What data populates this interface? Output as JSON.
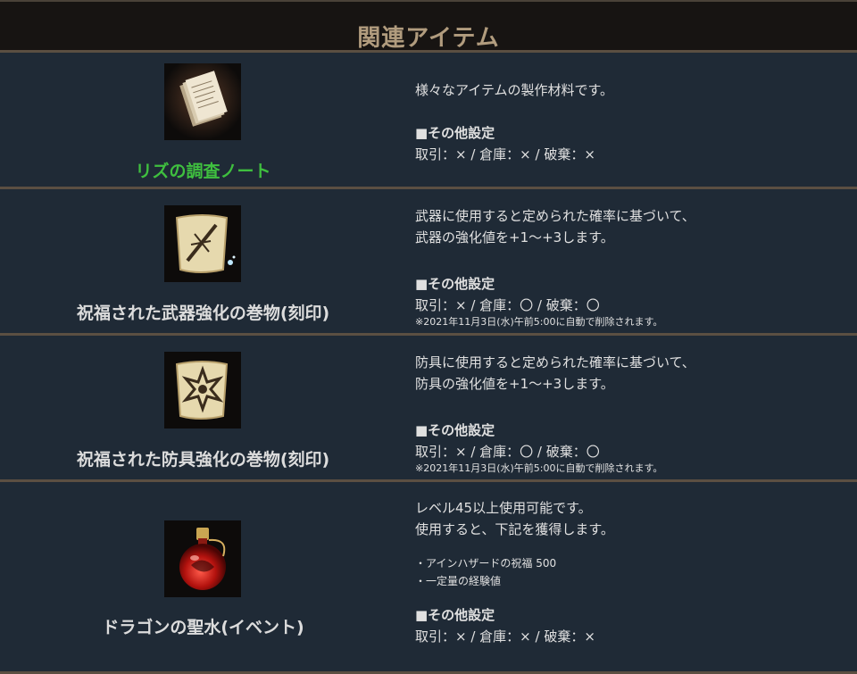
{
  "header": {
    "title": "関連アイテム"
  },
  "items": [
    {
      "name": "リズの調査ノート",
      "icon": "notes-icon",
      "desc": [
        "様々なアイテムの製作材料です。"
      ],
      "setting_label": "■その他設定",
      "setting_value": "取引：× / 倉庫：× / 破棄：×"
    },
    {
      "name": "祝福された武器強化の巻物(刻印)",
      "icon": "weapon-scroll-icon",
      "desc": [
        "武器に使用すると定められた確率に基づいて、",
        "武器の強化値を+1～+3します。"
      ],
      "setting_label": "■その他設定",
      "setting_value": "取引：× / 倉庫：〇 / 破棄：〇",
      "note": "※2021年11月3日(水)午前5:00に自動で削除されます。"
    },
    {
      "name": "祝福された防具強化の巻物(刻印)",
      "icon": "armor-scroll-icon",
      "desc": [
        "防具に使用すると定められた確率に基づいて、",
        "防具の強化値を+1～+3します。"
      ],
      "setting_label": "■その他設定",
      "setting_value": "取引：× / 倉庫：〇 / 破棄：〇",
      "note": "※2021年11月3日(水)午前5:00に自動で削除されます。"
    },
    {
      "name": "ドラゴンの聖水(イベント)",
      "icon": "red-potion-icon",
      "desc": [
        "レベル45以上使用可能です。",
        "使用すると、下記を獲得します。"
      ],
      "bullets": [
        "・アインハザードの祝福 500",
        "・一定量の経験値"
      ],
      "setting_label": "■その他設定",
      "setting_value": "取引：× / 倉庫：× / 破棄：×"
    }
  ]
}
